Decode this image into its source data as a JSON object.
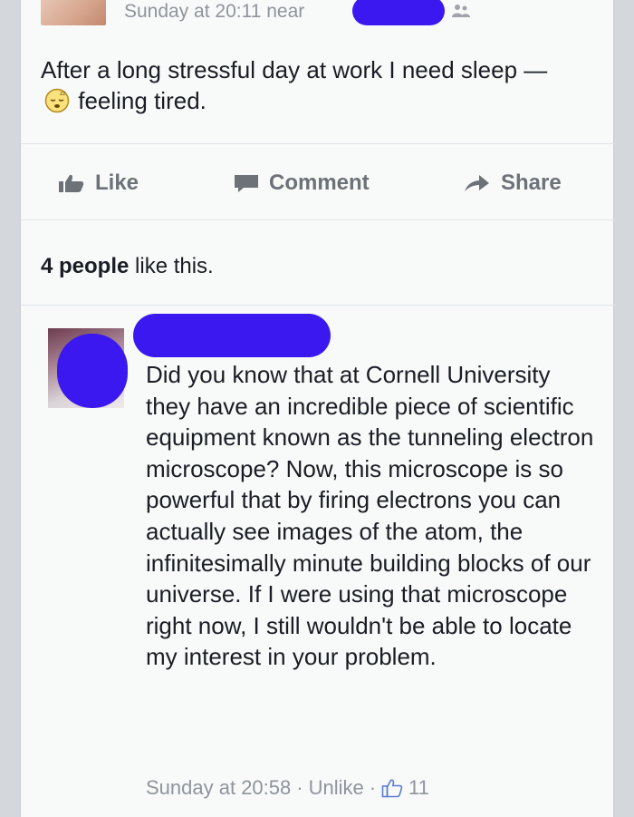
{
  "post": {
    "timestamp": "Sunday at 20:11",
    "location_prefix": "near",
    "text_before_feeling": "After a long stressful day at work I need sleep —",
    "feeling_text": "feeling tired."
  },
  "actions": {
    "like": "Like",
    "comment": "Comment",
    "share": "Share"
  },
  "likes": {
    "count_text": "4 people",
    "suffix": "like this."
  },
  "comment": {
    "text": "Did you know that at Cornell University they have an incredible piece of scientific equipment known as the tunneling electron microscope? Now, this microscope is so powerful that by firing electrons you can actually see images of the atom, the infinitesimally minute building blocks of our universe. If I were using that microscope right now, I still wouldn't be able to locate my interest in your problem.",
    "timestamp": "Sunday at 20:58",
    "separator": "·",
    "unlike": "Unlike",
    "like_count": "11"
  },
  "colors": {
    "redaction": "#3c18f0",
    "meta_text": "#90949c",
    "action_text": "#6d7178"
  }
}
